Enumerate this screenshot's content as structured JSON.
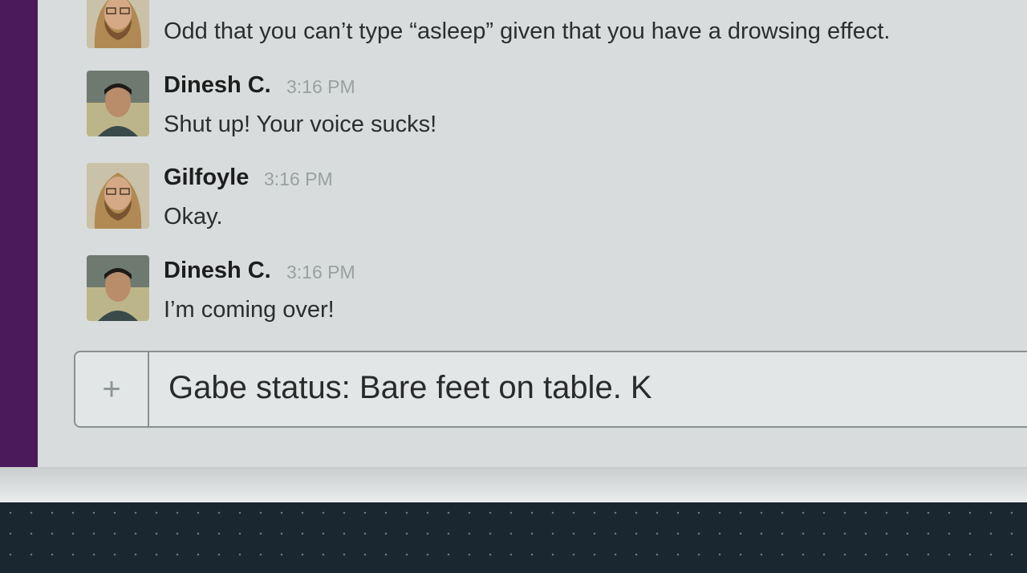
{
  "colors": {
    "sidebar": "#4b1a5a",
    "pane": "#d8dcdc",
    "timestamp": "#9aa0a0"
  },
  "messages": [
    {
      "sender": "",
      "avatar": "gilfoyle-avatar",
      "time": "",
      "text": "Odd that you can’t type “asleep” given that you have a drowsing effect."
    },
    {
      "sender": "Dinesh C.",
      "avatar": "dinesh-avatar",
      "time": "3:16 PM",
      "text": "Shut up! Your voice sucks!"
    },
    {
      "sender": "Gilfoyle",
      "avatar": "gilfoyle-avatar",
      "time": "3:16 PM",
      "text": "Okay."
    },
    {
      "sender": "Dinesh C.",
      "avatar": "dinesh-avatar",
      "time": "3:16 PM",
      "text": "I’m coming over!"
    }
  ],
  "composer": {
    "attach_icon": "plus-icon",
    "attach_glyph": "+",
    "value": "Gabe status: Bare feet on table. K"
  }
}
